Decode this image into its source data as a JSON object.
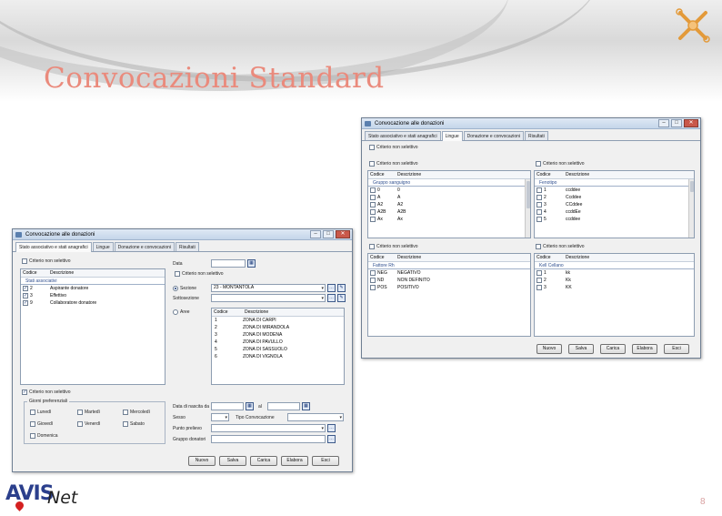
{
  "slide": {
    "title": "Convocazioni Standard",
    "page_number": "8",
    "logo_avis": "AVIS",
    "logo_net": "Net",
    "accent_color": "#ea8a7c"
  },
  "window_left": {
    "title": "Convocazione alle donazioni",
    "tabs": [
      "Stato associativo e stati anagrafici",
      "Lingue",
      "Donazione e convocazioni",
      "Risultati"
    ],
    "criteria_label": "Criterio non selettivo",
    "col_code": "Codice",
    "col_desc": "Descrizione",
    "group_title": "Stati associativi",
    "rows": [
      {
        "code": "2",
        "desc": "Aspirante donatore",
        "checked": true
      },
      {
        "code": "3",
        "desc": "Effettivo",
        "checked": true
      },
      {
        "code": "9",
        "desc": "Collaboratore donatore",
        "checked": true
      }
    ],
    "data_label": "Data",
    "criteria2_label": "Criterio non selettivo",
    "sottosezione_label": "Sottosezione",
    "sezione_label": "Sezione",
    "sezione_value": "23 - MONTANTOLA",
    "area_label": "Aree",
    "zone_col_code": "Codice",
    "zone_col_desc": "Descrizione",
    "zones": [
      {
        "code": "1",
        "desc": "ZONA DI CARPI"
      },
      {
        "code": "2",
        "desc": "ZONA DI MIRANDOLA"
      },
      {
        "code": "3",
        "desc": "ZONA DI MODENA"
      },
      {
        "code": "4",
        "desc": "ZONA DI PAVULLO"
      },
      {
        "code": "5",
        "desc": "ZONA DI SASSUOLO"
      },
      {
        "code": "6",
        "desc": "ZONA DI VIGNOLA"
      }
    ],
    "criteria3_label": "Criterio non selettivo",
    "days_group_title": "Giorni preferenziali",
    "days": [
      "Lunedì",
      "Martedì",
      "Mercoledì",
      "Giovedì",
      "Venerdì",
      "Sabato",
      "Domenica"
    ],
    "data_nascita_label": "Data di nascita da",
    "al_label": "al",
    "sesso_label": "Sesso",
    "tipo_label": "Tipo Convocazione",
    "punto_label": "Punto prelievo",
    "gruppo_label": "Gruppo donatori",
    "buttons": [
      "Nuovo",
      "Salva",
      "Carica",
      "Elabora",
      "Esci"
    ]
  },
  "window_right": {
    "title": "Convocazione alle donazioni",
    "tabs": [
      "Stato associativo e stati anagrafici",
      "Lingue",
      "Donazione e convocazioni",
      "Risultati"
    ],
    "criteria_label": "Criterio non selettivo",
    "lists": [
      {
        "criteria": "Criterio non selettivo",
        "col_code": "Codice",
        "col_desc": "Descrizione",
        "group": "Gruppo sanguigno",
        "rows": [
          {
            "code": "0",
            "desc": "0"
          },
          {
            "code": "A",
            "desc": "A"
          },
          {
            "code": "A2",
            "desc": "A2"
          },
          {
            "code": "A2B",
            "desc": "A2B"
          },
          {
            "code": "Ax",
            "desc": "Ax"
          }
        ]
      },
      {
        "criteria": "Criterio non selettivo",
        "col_code": "Codice",
        "col_desc": "Descrizione",
        "group": "Fenotipo",
        "rows": [
          {
            "code": "1",
            "desc": "ccddee"
          },
          {
            "code": "2",
            "desc": "Ccddee"
          },
          {
            "code": "3",
            "desc": "CCddee"
          },
          {
            "code": "4",
            "desc": "ccddEe"
          },
          {
            "code": "5",
            "desc": "ccddee"
          }
        ]
      },
      {
        "criteria": "Criterio non selettivo",
        "col_code": "Codice",
        "col_desc": "Descrizione",
        "group": "Fattore Rh",
        "rows": [
          {
            "code": "NEG",
            "desc": "NEGATIVO"
          },
          {
            "code": "ND",
            "desc": "NON DEFINITO"
          },
          {
            "code": "POS",
            "desc": "POSITIVO"
          }
        ]
      },
      {
        "criteria": "Criterio non selettivo",
        "col_code": "Codice",
        "col_desc": "Descrizione",
        "group": "Kell Cellano",
        "rows": [
          {
            "code": "1",
            "desc": "kk"
          },
          {
            "code": "2",
            "desc": "Kk"
          },
          {
            "code": "3",
            "desc": "KK"
          }
        ]
      }
    ],
    "buttons": [
      "Nuovo",
      "Salva",
      "Carica",
      "Elabora",
      "Esci"
    ]
  }
}
